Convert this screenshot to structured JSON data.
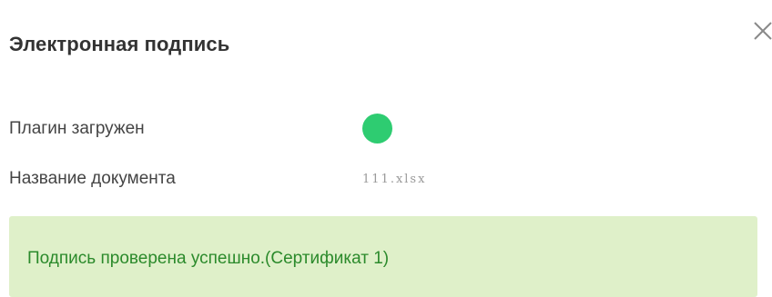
{
  "dialog": {
    "title": "Электронная подпись",
    "close_icon": "close-icon"
  },
  "fields": {
    "plugin_label": "Плагин загружен",
    "plugin_status": "loaded",
    "plugin_status_color": "#2ecc71",
    "document_label": "Название документа",
    "document_value": "111.xlsx"
  },
  "alert": {
    "message": "Подпись проверена успешно.(Сертификат 1)",
    "background": "#dff0c9",
    "text_color": "#2b8a2b"
  }
}
